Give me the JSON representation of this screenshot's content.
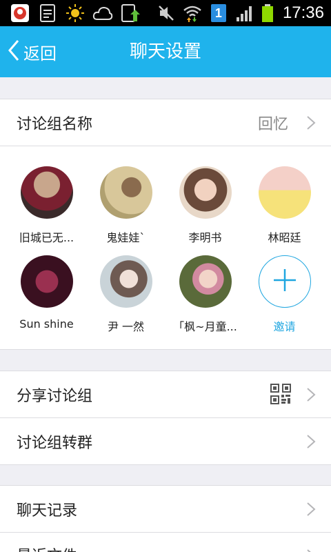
{
  "status_bar": {
    "time": "17:36",
    "notification_badge": "1",
    "icons": [
      "app-notification-icon",
      "document-icon",
      "weather-sun-icon",
      "weather-cloud-icon",
      "upload-icon",
      "mute-icon",
      "wifi-icon",
      "sim-icon",
      "signal-icon",
      "battery-icon"
    ]
  },
  "header": {
    "back_label": "返回",
    "title": "聊天设置"
  },
  "group_name_row": {
    "label": "讨论组名称",
    "value": "回忆"
  },
  "members": [
    {
      "name": "旧城已无...",
      "avatar_colors": [
        "#7a2030",
        "#c8a68c"
      ]
    },
    {
      "name": "鬼娃娃`",
      "avatar_colors": [
        "#d8c79a",
        "#8a6b4e"
      ]
    },
    {
      "name": "李明书",
      "avatar_colors": [
        "#f1d2c0",
        "#6a4a3a"
      ]
    },
    {
      "name": "林昭廷",
      "avatar_colors": [
        "#f6e27a",
        "#f4b6b0"
      ]
    },
    {
      "name": "Sun shine",
      "avatar_colors": [
        "#3a1020",
        "#9a3050"
      ]
    },
    {
      "name": "尹  一然",
      "avatar_colors": [
        "#c9d3d8",
        "#6e5a52"
      ]
    },
    {
      "name": "「枫~月童...",
      "avatar_colors": [
        "#5a6a3a",
        "#d28aa0"
      ]
    }
  ],
  "invite_label": "邀请",
  "share_row": {
    "label": "分享讨论组"
  },
  "convert_row": {
    "label": "讨论组转群"
  },
  "history_row": {
    "label": "聊天记录"
  },
  "files_row": {
    "label": "最近文件"
  },
  "colors": {
    "accent": "#1fb3ec",
    "invite": "#1fa6e0"
  }
}
